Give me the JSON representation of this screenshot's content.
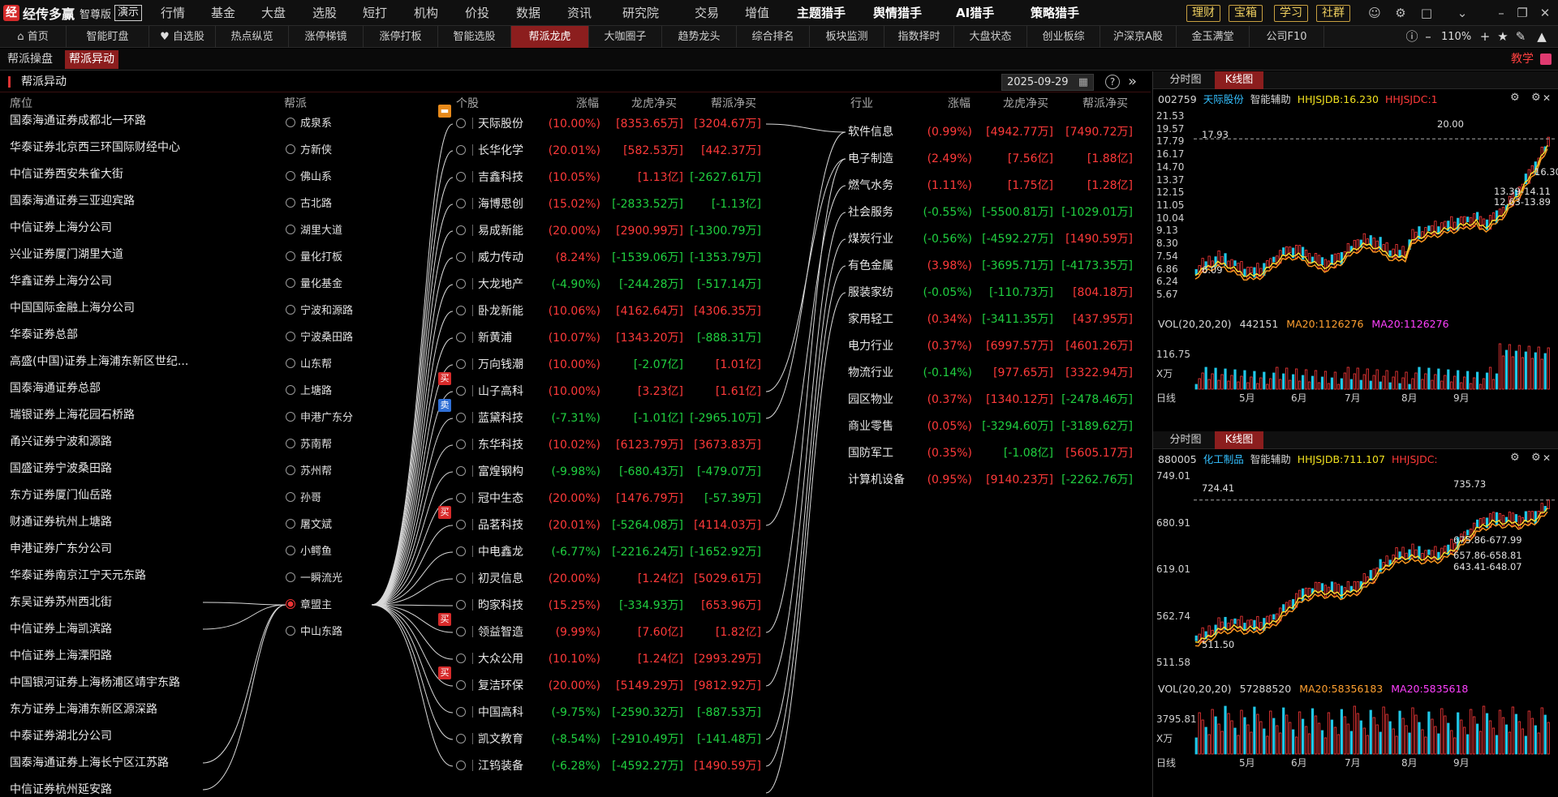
{
  "app": {
    "name": "经传多赢",
    "edition": "智尊版",
    "demo": "演示",
    "logo_mark": "经"
  },
  "top_menu": [
    {
      "label": "行情",
      "dot": false
    },
    {
      "label": "基金",
      "dot": false
    },
    {
      "label": "大盘",
      "dot": false
    },
    {
      "label": "选股",
      "dot": false
    },
    {
      "label": "短打",
      "dot": false
    },
    {
      "label": "机构",
      "dot": false
    },
    {
      "label": "价投",
      "dot": false
    },
    {
      "label": "数据",
      "dot": true
    },
    {
      "label": "资讯",
      "dot": false
    },
    {
      "label": "研究院",
      "dot": true
    },
    {
      "label": "交易",
      "dot": false
    },
    {
      "label": "增值",
      "dot": false
    }
  ],
  "top_menu_bold": [
    "主题猎手",
    "舆情猎手",
    "AI猎手",
    "策略猎手"
  ],
  "top_buttons": [
    "理财",
    "宝箱",
    "学习",
    "社群"
  ],
  "tabs": [
    "首页",
    "智能盯盘",
    "自选股",
    "热点纵览",
    "涨停梯镜",
    "涨停打板",
    "智能选股",
    "帮派龙虎",
    "大咖圈子",
    "趋势龙头",
    "综合排名",
    "板块监测",
    "指数择时",
    "大盘状态",
    "创业板综",
    "沪深京A股",
    "金玉满堂",
    "公司F10"
  ],
  "active_tab": "帮派龙虎",
  "zoom": "110%",
  "sub_tabs": [
    "帮派操盘",
    "帮派异动"
  ],
  "active_sub_tab": "帮派异动",
  "teach_label": "教学",
  "section": {
    "title": "帮派异动",
    "date": "2025-09-29"
  },
  "headers": {
    "seat": "席位",
    "faction": "帮派",
    "stock": "个股",
    "chg": "涨幅",
    "lh_net": "龙虎净买",
    "bp_net": "帮派净买",
    "industry": "行业",
    "ind_chg": "涨幅",
    "ind_lh": "龙虎净买",
    "ind_bp": "帮派净买"
  },
  "seats": [
    "国泰海通证券成都北一环路",
    "华泰证券北京西三环国际财经中心",
    "中信证券西安朱雀大街",
    "国泰海通证券三亚迎宾路",
    "中信证券上海分公司",
    "兴业证券厦门湖里大道",
    "华鑫证券上海分公司",
    "中国国际金融上海分公司",
    "华泰证券总部",
    "高盛(中国)证券上海浦东新区世纪...",
    "国泰海通证券总部",
    "瑞银证券上海花园石桥路",
    "甬兴证券宁波和源路",
    "国盛证券宁波桑田路",
    "东方证券厦门仙岳路",
    "财通证券杭州上塘路",
    "申港证券广东分公司",
    "华泰证券南京江宁天元东路",
    "东吴证券苏州西北街",
    "中信证券上海凯滨路",
    "中信证券上海溧阳路",
    "中国银河证券上海杨浦区靖宇东路",
    "东方证券上海浦东新区源深路",
    "中泰证券湖北分公司",
    "国泰海通证券上海长宁区江苏路",
    "中信证券杭州延安路"
  ],
  "factions": [
    {
      "name": "成泉系",
      "selected": false
    },
    {
      "name": "方新侠",
      "selected": false
    },
    {
      "name": "佛山系",
      "selected": false
    },
    {
      "name": "古北路",
      "selected": false
    },
    {
      "name": "湖里大道",
      "selected": false
    },
    {
      "name": "量化打板",
      "selected": false
    },
    {
      "name": "量化基金",
      "selected": false
    },
    {
      "name": "宁波和源路",
      "selected": false
    },
    {
      "name": "宁波桑田路",
      "selected": false
    },
    {
      "name": "山东帮",
      "selected": false
    },
    {
      "name": "上塘路",
      "selected": false
    },
    {
      "name": "申港广东分",
      "selected": false
    },
    {
      "name": "苏南帮",
      "selected": false
    },
    {
      "name": "苏州帮",
      "selected": false
    },
    {
      "name": "孙哥",
      "selected": false
    },
    {
      "name": "屠文斌",
      "selected": false
    },
    {
      "name": "小鳄鱼",
      "selected": false
    },
    {
      "name": "一瞬流光",
      "selected": false
    },
    {
      "name": "章盟主",
      "selected": true
    },
    {
      "name": "中山东路",
      "selected": false
    }
  ],
  "stocks": [
    {
      "name": "天际股份",
      "chg": "(10.00%)",
      "lh": "[8353.65万]",
      "bp": "[3204.67万]",
      "c1": "red",
      "c2": "red",
      "c3": "red",
      "badge": "o"
    },
    {
      "name": "长华化学",
      "chg": "(20.01%)",
      "lh": "[582.53万]",
      "bp": "[442.37万]",
      "c1": "red",
      "c2": "red",
      "c3": "red",
      "badge": ""
    },
    {
      "name": "吉鑫科技",
      "chg": "(10.05%)",
      "lh": "[1.13亿]",
      "bp": "[-2627.61万]",
      "c1": "red",
      "c2": "red",
      "c3": "grn",
      "badge": ""
    },
    {
      "name": "海博思创",
      "chg": "(15.02%)",
      "lh": "[-2833.52万]",
      "bp": "[-1.13亿]",
      "c1": "red",
      "c2": "grn",
      "c3": "grn",
      "badge": ""
    },
    {
      "name": "易成新能",
      "chg": "(20.00%)",
      "lh": "[2900.99万]",
      "bp": "[-1300.79万]",
      "c1": "red",
      "c2": "red",
      "c3": "grn",
      "badge": ""
    },
    {
      "name": "威力传动",
      "chg": "(8.24%)",
      "lh": "[-1539.06万]",
      "bp": "[-1353.79万]",
      "c1": "red",
      "c2": "grn",
      "c3": "grn",
      "badge": ""
    },
    {
      "name": "大龙地产",
      "chg": "(-4.90%)",
      "lh": "[-244.28万]",
      "bp": "[-517.14万]",
      "c1": "grn",
      "c2": "grn",
      "c3": "grn",
      "badge": ""
    },
    {
      "name": "卧龙新能",
      "chg": "(10.06%)",
      "lh": "[4162.64万]",
      "bp": "[4306.35万]",
      "c1": "red",
      "c2": "red",
      "c3": "red",
      "badge": ""
    },
    {
      "name": "新黄浦",
      "chg": "(10.07%)",
      "lh": "[1343.20万]",
      "bp": "[-888.31万]",
      "c1": "red",
      "c2": "red",
      "c3": "grn",
      "badge": ""
    },
    {
      "name": "万向钱潮",
      "chg": "(10.00%)",
      "lh": "[-2.07亿]",
      "bp": "[1.01亿]",
      "c1": "red",
      "c2": "grn",
      "c3": "red",
      "badge": ""
    },
    {
      "name": "山子高科",
      "chg": "(10.00%)",
      "lh": "[3.23亿]",
      "bp": "[1.61亿]",
      "c1": "red",
      "c2": "red",
      "c3": "red",
      "badge": "r"
    },
    {
      "name": "蓝黛科技",
      "chg": "(-7.31%)",
      "lh": "[-1.01亿]",
      "bp": "[-2965.10万]",
      "c1": "grn",
      "c2": "grn",
      "c3": "grn",
      "badge": "b"
    },
    {
      "name": "东华科技",
      "chg": "(10.02%)",
      "lh": "[6123.79万]",
      "bp": "[3673.83万]",
      "c1": "red",
      "c2": "red",
      "c3": "red",
      "badge": ""
    },
    {
      "name": "富煌钢构",
      "chg": "(-9.98%)",
      "lh": "[-680.43万]",
      "bp": "[-479.07万]",
      "c1": "grn",
      "c2": "grn",
      "c3": "grn",
      "badge": ""
    },
    {
      "name": "冠中生态",
      "chg": "(20.00%)",
      "lh": "[1476.79万]",
      "bp": "[-57.39万]",
      "c1": "red",
      "c2": "red",
      "c3": "grn",
      "badge": ""
    },
    {
      "name": "品茗科技",
      "chg": "(20.01%)",
      "lh": "[-5264.08万]",
      "bp": "[4114.03万]",
      "c1": "red",
      "c2": "grn",
      "c3": "red",
      "badge": "r"
    },
    {
      "name": "中电鑫龙",
      "chg": "(-6.77%)",
      "lh": "[-2216.24万]",
      "bp": "[-1652.92万]",
      "c1": "grn",
      "c2": "grn",
      "c3": "grn",
      "badge": ""
    },
    {
      "name": "初灵信息",
      "chg": "(20.00%)",
      "lh": "[1.24亿]",
      "bp": "[5029.61万]",
      "c1": "red",
      "c2": "red",
      "c3": "red",
      "badge": ""
    },
    {
      "name": "昀家科技",
      "chg": "(15.25%)",
      "lh": "[-334.93万]",
      "bp": "[653.96万]",
      "c1": "red",
      "c2": "grn",
      "c3": "red",
      "badge": ""
    },
    {
      "name": "领益智造",
      "chg": "(9.99%)",
      "lh": "[7.60亿]",
      "bp": "[1.82亿]",
      "c1": "red",
      "c2": "red",
      "c3": "red",
      "badge": "r"
    },
    {
      "name": "大众公用",
      "chg": "(10.10%)",
      "lh": "[1.24亿]",
      "bp": "[2993.29万]",
      "c1": "red",
      "c2": "red",
      "c3": "red",
      "badge": ""
    },
    {
      "name": "复洁环保",
      "chg": "(20.00%)",
      "lh": "[5149.29万]",
      "bp": "[9812.92万]",
      "c1": "red",
      "c2": "red",
      "c3": "red",
      "badge": "r"
    },
    {
      "name": "中国高科",
      "chg": "(-9.75%)",
      "lh": "[-2590.32万]",
      "bp": "[-887.53万]",
      "c1": "grn",
      "c2": "grn",
      "c3": "grn",
      "badge": ""
    },
    {
      "name": "凯文教育",
      "chg": "(-8.54%)",
      "lh": "[-2910.49万]",
      "bp": "[-141.48万]",
      "c1": "grn",
      "c2": "grn",
      "c3": "grn",
      "badge": ""
    },
    {
      "name": "江钨装备",
      "chg": "(-6.28%)",
      "lh": "[-4592.27万]",
      "bp": "[1490.59万]",
      "c1": "grn",
      "c2": "grn",
      "c3": "red",
      "badge": ""
    }
  ],
  "industries": [
    {
      "name": "软件信息",
      "chg": "(0.99%)",
      "lh": "[4942.77万]",
      "bp": "[7490.72万]",
      "c1": "red",
      "c2": "red",
      "c3": "red"
    },
    {
      "name": "电子制造",
      "chg": "(2.49%)",
      "lh": "[7.56亿]",
      "bp": "[1.88亿]",
      "c1": "red",
      "c2": "red",
      "c3": "red"
    },
    {
      "name": "燃气水务",
      "chg": "(1.11%)",
      "lh": "[1.75亿]",
      "bp": "[1.28亿]",
      "c1": "red",
      "c2": "red",
      "c3": "red"
    },
    {
      "name": "社会服务",
      "chg": "(-0.55%)",
      "lh": "[-5500.81万]",
      "bp": "[-1029.01万]",
      "c1": "grn",
      "c2": "grn",
      "c3": "grn"
    },
    {
      "name": "煤炭行业",
      "chg": "(-0.56%)",
      "lh": "[-4592.27万]",
      "bp": "[1490.59万]",
      "c1": "grn",
      "c2": "grn",
      "c3": "red"
    },
    {
      "name": "有色金属",
      "chg": "(3.98%)",
      "lh": "[-3695.71万]",
      "bp": "[-4173.35万]",
      "c1": "red",
      "c2": "grn",
      "c3": "grn"
    },
    {
      "name": "服装家纺",
      "chg": "(-0.05%)",
      "lh": "[-110.73万]",
      "bp": "[804.18万]",
      "c1": "grn",
      "c2": "grn",
      "c3": "red"
    },
    {
      "name": "家用轻工",
      "chg": "(0.34%)",
      "lh": "[-3411.35万]",
      "bp": "[437.95万]",
      "c1": "red",
      "c2": "grn",
      "c3": "red"
    },
    {
      "name": "电力行业",
      "chg": "(0.37%)",
      "lh": "[6997.57万]",
      "bp": "[4601.26万]",
      "c1": "red",
      "c2": "red",
      "c3": "red"
    },
    {
      "name": "物流行业",
      "chg": "(-0.14%)",
      "lh": "[977.65万]",
      "bp": "[3322.94万]",
      "c1": "grn",
      "c2": "red",
      "c3": "red"
    },
    {
      "name": "园区物业",
      "chg": "(0.37%)",
      "lh": "[1340.12万]",
      "bp": "[-2478.46万]",
      "c1": "red",
      "c2": "red",
      "c3": "grn"
    },
    {
      "name": "商业零售",
      "chg": "(0.05%)",
      "lh": "[-3294.60万]",
      "bp": "[-3189.62万]",
      "c1": "red",
      "c2": "grn",
      "c3": "grn"
    },
    {
      "name": "国防军工",
      "chg": "(0.35%)",
      "lh": "[-1.08亿]",
      "bp": "[5605.17万]",
      "c1": "red",
      "c2": "grn",
      "c3": "red"
    },
    {
      "name": "计算机设备",
      "chg": "(0.95%)",
      "lh": "[9140.23万]",
      "bp": "[-2262.76万]",
      "c1": "red",
      "c2": "red",
      "c3": "grn"
    }
  ],
  "charts": [
    {
      "tabs": [
        "分时图",
        "K线图"
      ],
      "active": "K线图",
      "code": "002759",
      "name": "天际股份",
      "assist": "智能辅助",
      "ind1": "HHJSJDB:16.230",
      "ind2": "HHJSJDC:1",
      "y_labels": [
        "21.53",
        "19.57",
        "17.79",
        "16.17",
        "14.70",
        "13.37",
        "12.15",
        "11.05",
        "10.04",
        "9.13",
        "8.30",
        "7.54",
        "6.86",
        "6.24",
        "5.67"
      ],
      "annotations": [
        "17.93",
        "20.00",
        "6.09",
        "16.30",
        "13.39-14.11",
        "12.63-13.89"
      ],
      "vol_label": "VOL(20,20,20)",
      "vol": "442151",
      "ma1": "MA20:1126276",
      "ma2": "MA20:1126276",
      "vol_y": "116.75",
      "unit": "X万",
      "x_labels": [
        "日线",
        "5月",
        "6月",
        "7月",
        "8月",
        "9月"
      ],
      "chart_data": {
        "type": "candlestick",
        "y_range": [
          5.67,
          21.53
        ],
        "low": 6.09,
        "high": 20.0,
        "last": 16.3
      }
    },
    {
      "tabs": [
        "分时图",
        "K线图"
      ],
      "active": "K线图",
      "code": "880005",
      "name": "化工制品",
      "assist": "智能辅助",
      "ind1": "HHJSJDB:711.107",
      "ind2": "HHJSJDC:",
      "y_labels": [
        "749.01",
        "680.91",
        "619.01",
        "562.74",
        "511.58"
      ],
      "annotations": [
        "724.41",
        "735.73",
        "675.86-677.99",
        "657.86-658.81",
        "643.41-648.07",
        "511.50"
      ],
      "vol_label": "VOL(20,20,20)",
      "vol": "57288520",
      "ma1": "MA20:58356183",
      "ma2": "MA20:5835618",
      "vol_y": "3795.81",
      "unit": "X万",
      "x_labels": [
        "日线",
        "5月",
        "6月",
        "7月",
        "8月",
        "9月"
      ],
      "chart_data": {
        "type": "candlestick",
        "y_range": [
          511.58,
          749.01
        ],
        "low": 511.5,
        "high": 735.73
      }
    }
  ],
  "colors": {
    "up": "#ff3a3a",
    "down": "#20d040",
    "active_tab": "#8c1e1e",
    "accent": "#34c0ff"
  }
}
